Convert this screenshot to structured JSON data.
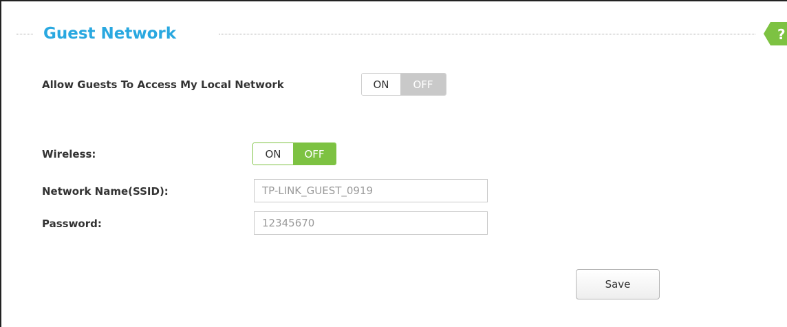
{
  "section": {
    "title": "Guest Network",
    "help_label": "?"
  },
  "guest_access": {
    "label": "Allow Guests To Access My Local Network",
    "on_label": "ON",
    "off_label": "OFF",
    "state": "OFF"
  },
  "wireless": {
    "label": "Wireless:",
    "on_label": "ON",
    "off_label": "OFF",
    "state": "OFF"
  },
  "ssid": {
    "label": "Network Name(SSID):",
    "value": "TP-LINK_GUEST_0919"
  },
  "password": {
    "label": "Password:",
    "value": "12345670"
  },
  "actions": {
    "save_label": "Save"
  },
  "colors": {
    "title_blue": "#29a8e0",
    "toggle_green": "#7dc242",
    "toggle_grey": "#c9c9c9"
  }
}
